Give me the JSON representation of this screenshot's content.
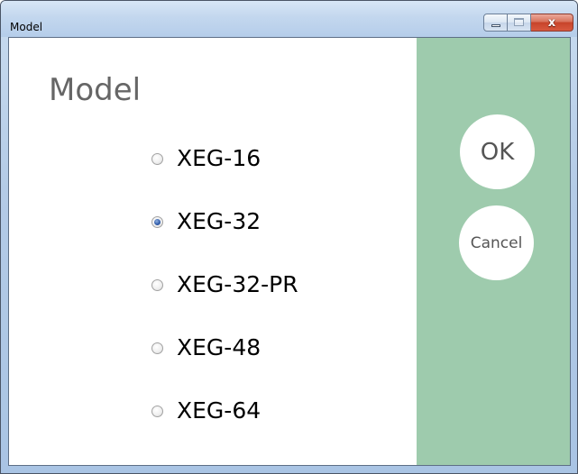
{
  "window": {
    "title": "Model",
    "close_glyph": "x"
  },
  "main": {
    "heading": "Model",
    "options": [
      {
        "label": "XEG-16",
        "selected": false
      },
      {
        "label": "XEG-32",
        "selected": true
      },
      {
        "label": "XEG-32-PR",
        "selected": false
      },
      {
        "label": "XEG-48",
        "selected": false
      },
      {
        "label": "XEG-64",
        "selected": false
      }
    ]
  },
  "side": {
    "ok_label": "OK",
    "cancel_label": "Cancel"
  },
  "colors": {
    "side_panel": "#9ecbad",
    "heading_text": "#666666",
    "button_text": "#555555",
    "close_button": "#c7442a"
  },
  "icons": {
    "minimize": "minimize-icon",
    "maximize": "maximize-icon",
    "close": "close-icon"
  }
}
